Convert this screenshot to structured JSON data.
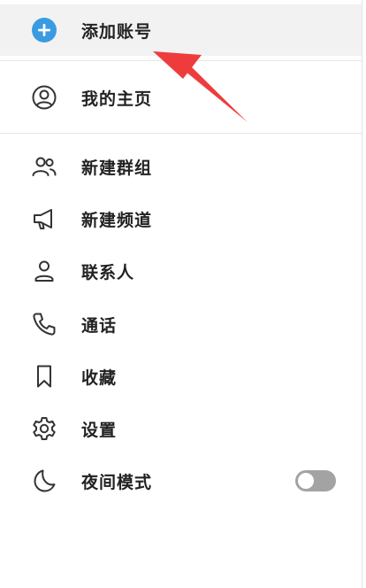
{
  "menu": {
    "add_account": "添加账号",
    "my_home": "我的主页",
    "items": [
      {
        "label": "新建群组",
        "icon": "group-icon"
      },
      {
        "label": "新建频道",
        "icon": "megaphone-icon"
      },
      {
        "label": "联系人",
        "icon": "person-icon"
      },
      {
        "label": "通话",
        "icon": "phone-icon"
      },
      {
        "label": "收藏",
        "icon": "bookmark-icon"
      },
      {
        "label": "设置",
        "icon": "gear-icon"
      },
      {
        "label": "夜间模式",
        "icon": "moon-icon"
      }
    ],
    "night_mode_enabled": false
  },
  "colors": {
    "accent": "#3a9be2",
    "annotation_arrow": "#ee3c3c",
    "toggle_off": "#a3a3a3"
  }
}
